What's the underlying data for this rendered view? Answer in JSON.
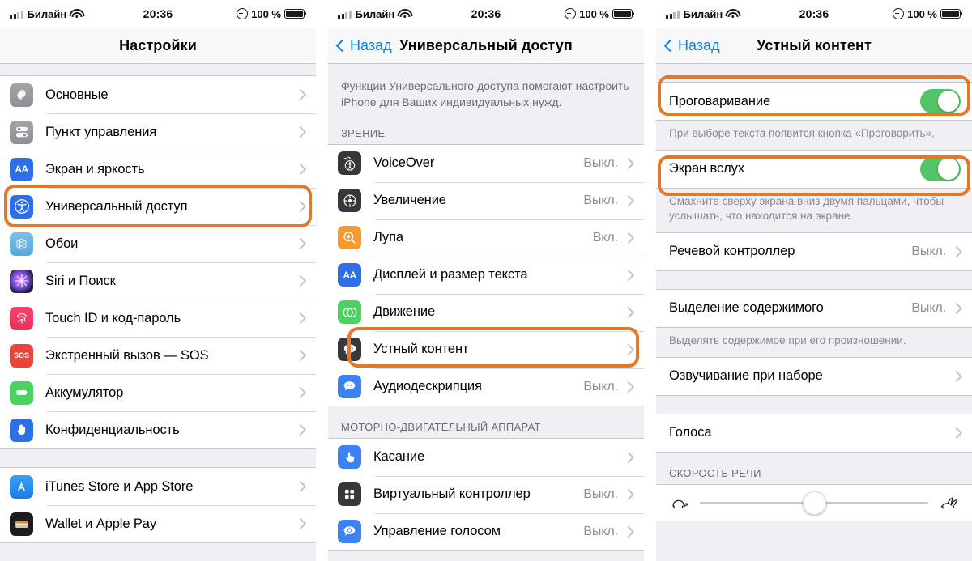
{
  "status_bar": {
    "carrier": "Билайн",
    "time": "20:36",
    "battery_percent": "100 %",
    "signal_icon": "signal-bars-icon",
    "wifi_icon": "wifi-icon",
    "lock_icon": "alarm-lock-icon",
    "battery_icon": "battery-full-icon"
  },
  "colors": {
    "highlight": "#e3782a",
    "toggle_on": "#53c466",
    "accent_blue": "#0b7cf5",
    "group_bg": "#ffffff",
    "page_bg": "#efeff4",
    "value_gray": "#8e8e93"
  },
  "panel1": {
    "nav": {
      "title": "Настройки",
      "has_back": false
    },
    "groups": [
      {
        "rows": [
          {
            "label": "Основные",
            "icon": "gear-icon",
            "value": "",
            "chevron": true,
            "highlighted": false
          },
          {
            "label": "Пункт управления",
            "icon": "control-center-icon",
            "value": "",
            "chevron": true,
            "highlighted": false
          },
          {
            "label": "Экран и яркость",
            "icon": "display-brightness-icon",
            "value": "",
            "chevron": true,
            "highlighted": false
          },
          {
            "label": "Универсальный доступ",
            "icon": "accessibility-icon",
            "value": "",
            "chevron": true,
            "highlighted": true
          },
          {
            "label": "Обои",
            "icon": "wallpaper-icon",
            "value": "",
            "chevron": true,
            "highlighted": false
          },
          {
            "label": "Siri и Поиск",
            "icon": "siri-icon",
            "value": "",
            "chevron": true,
            "highlighted": false
          },
          {
            "label": "Touch ID и код-пароль",
            "icon": "touch-id-icon",
            "value": "",
            "chevron": true,
            "highlighted": false
          },
          {
            "label": "Экстренный вызов — SOS",
            "icon": "sos-icon",
            "value": "",
            "chevron": true,
            "highlighted": false
          },
          {
            "label": "Аккумулятор",
            "icon": "battery-icon",
            "value": "",
            "chevron": true,
            "highlighted": false
          },
          {
            "label": "Конфиденциальность",
            "icon": "privacy-hand-icon",
            "value": "",
            "chevron": true,
            "highlighted": false
          }
        ]
      },
      {
        "rows": [
          {
            "label": "iTunes Store и App Store",
            "icon": "app-store-icon",
            "value": "",
            "chevron": true,
            "highlighted": false
          },
          {
            "label": "Wallet и Apple Pay",
            "icon": "wallet-icon",
            "value": "",
            "chevron": true,
            "highlighted": false
          }
        ]
      }
    ]
  },
  "panel2": {
    "nav": {
      "back_label": "Назад",
      "title": "Универсальный доступ",
      "has_back": true
    },
    "intro": "Функции Универсального доступа помогают настроить iPhone для Ваших индивидуальных нужд.",
    "section1_header": "ЗРЕНИЕ",
    "section1_rows": [
      {
        "label": "VoiceOver",
        "icon": "voiceover-icon",
        "value": "Выкл.",
        "chevron": true,
        "highlighted": false
      },
      {
        "label": "Увеличение",
        "icon": "zoom-icon",
        "value": "Выкл.",
        "chevron": true,
        "highlighted": false
      },
      {
        "label": "Лупа",
        "icon": "magnifier-icon",
        "value": "Вкл.",
        "chevron": true,
        "highlighted": false
      },
      {
        "label": "Дисплей и размер текста",
        "icon": "display-text-size-icon",
        "value": "",
        "chevron": true,
        "highlighted": false
      },
      {
        "label": "Движение",
        "icon": "motion-icon",
        "value": "",
        "chevron": true,
        "highlighted": false
      },
      {
        "label": "Устный контент",
        "icon": "spoken-content-icon",
        "value": "",
        "chevron": true,
        "highlighted": true
      },
      {
        "label": "Аудиодескрипция",
        "icon": "audio-description-icon",
        "value": "Выкл.",
        "chevron": true,
        "highlighted": false
      }
    ],
    "section2_header": "МОТОРНО-ДВИГАТЕЛЬНЫЙ АППАРАТ",
    "section2_rows": [
      {
        "label": "Касание",
        "icon": "touch-icon",
        "value": "",
        "chevron": true,
        "highlighted": false
      },
      {
        "label": "Виртуальный контроллер",
        "icon": "switch-control-icon",
        "value": "Выкл.",
        "chevron": true,
        "highlighted": false
      },
      {
        "label": "Управление голосом",
        "icon": "voice-control-icon",
        "value": "Выкл.",
        "chevron": true,
        "highlighted": false
      }
    ]
  },
  "panel3": {
    "nav": {
      "back_label": "Назад",
      "title": "Устный контент",
      "has_back": true
    },
    "blocks": [
      {
        "type": "toggle",
        "label": "Проговаривание",
        "toggle_state": "on",
        "highlighted": true,
        "footnote": "При выборе текста появится кнопка «Проговорить»."
      },
      {
        "type": "toggle",
        "label": "Экран вслух",
        "toggle_state": "on",
        "highlighted": true,
        "footnote": "Смахните сверху экрана вниз двумя пальцами, чтобы услышать, что находится на экране."
      },
      {
        "type": "link",
        "label": "Речевой контроллер",
        "value": "Выкл.",
        "highlighted": false,
        "footnote": ""
      },
      {
        "type": "link",
        "label": "Выделение содержимого",
        "value": "Выкл.",
        "highlighted": false,
        "footnote": "Выделять содержимое при его произношении."
      },
      {
        "type": "link",
        "label": "Озвучивание при наборе",
        "value": "",
        "highlighted": false,
        "footnote": ""
      },
      {
        "type": "link",
        "label": "Голоса",
        "value": "",
        "highlighted": false,
        "footnote": ""
      }
    ],
    "speech_rate_header": "СКОРОСТЬ РЕЧИ",
    "speech_rate_slider": {
      "left_icon": "tortoise-icon",
      "right_icon": "hare-icon",
      "position_percent": 45
    }
  }
}
